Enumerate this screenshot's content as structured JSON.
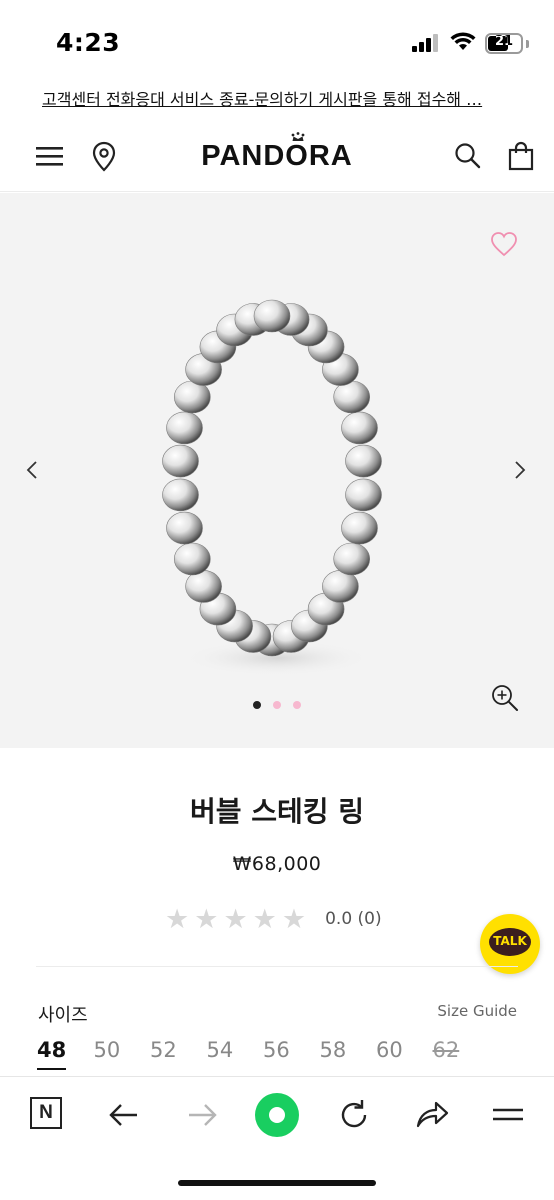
{
  "status_bar": {
    "time": "4:23",
    "battery_level": "21",
    "icons": [
      "signal-icon",
      "wifi-icon",
      "battery-icon"
    ]
  },
  "notice": {
    "text": "고객센터 전화응대 서비스 종료-문의하기 게시판을 통해 접수해 …"
  },
  "header": {
    "logo": "PANDORA",
    "icons": [
      "menu-icon",
      "location-pin-icon",
      "search-icon",
      "shopping-bag-icon"
    ]
  },
  "gallery": {
    "slide_count": 3,
    "active_slide": 1,
    "icons": [
      "heart-icon",
      "chevron-left-icon",
      "chevron-right-icon",
      "zoom-in-icon"
    ],
    "colors": {
      "background": "#f3f3f3",
      "dot_active": "#222222",
      "dot_inactive": "#f7b8cf",
      "heart": "#f08fb0"
    }
  },
  "product": {
    "title": "버블 스테킹 링",
    "price": "₩68,000",
    "rating_stars": 0,
    "rating_text": "0.0 (0)"
  },
  "chat": {
    "label": "TALK",
    "color": "#ffe000"
  },
  "sizes": {
    "label": "사이즈",
    "guide_label": "Size Guide",
    "options": [
      "48",
      "50",
      "52",
      "54",
      "56",
      "58",
      "60",
      "62"
    ],
    "selected": "48",
    "sold_out": [
      "62"
    ]
  },
  "browser_toolbar": {
    "naver_label": "N",
    "icons": [
      "naver-home-icon",
      "back-arrow-icon",
      "forward-arrow-icon",
      "green-dot-button",
      "refresh-icon",
      "share-icon",
      "menu-lines-icon"
    ],
    "accent": "#19ce60"
  }
}
